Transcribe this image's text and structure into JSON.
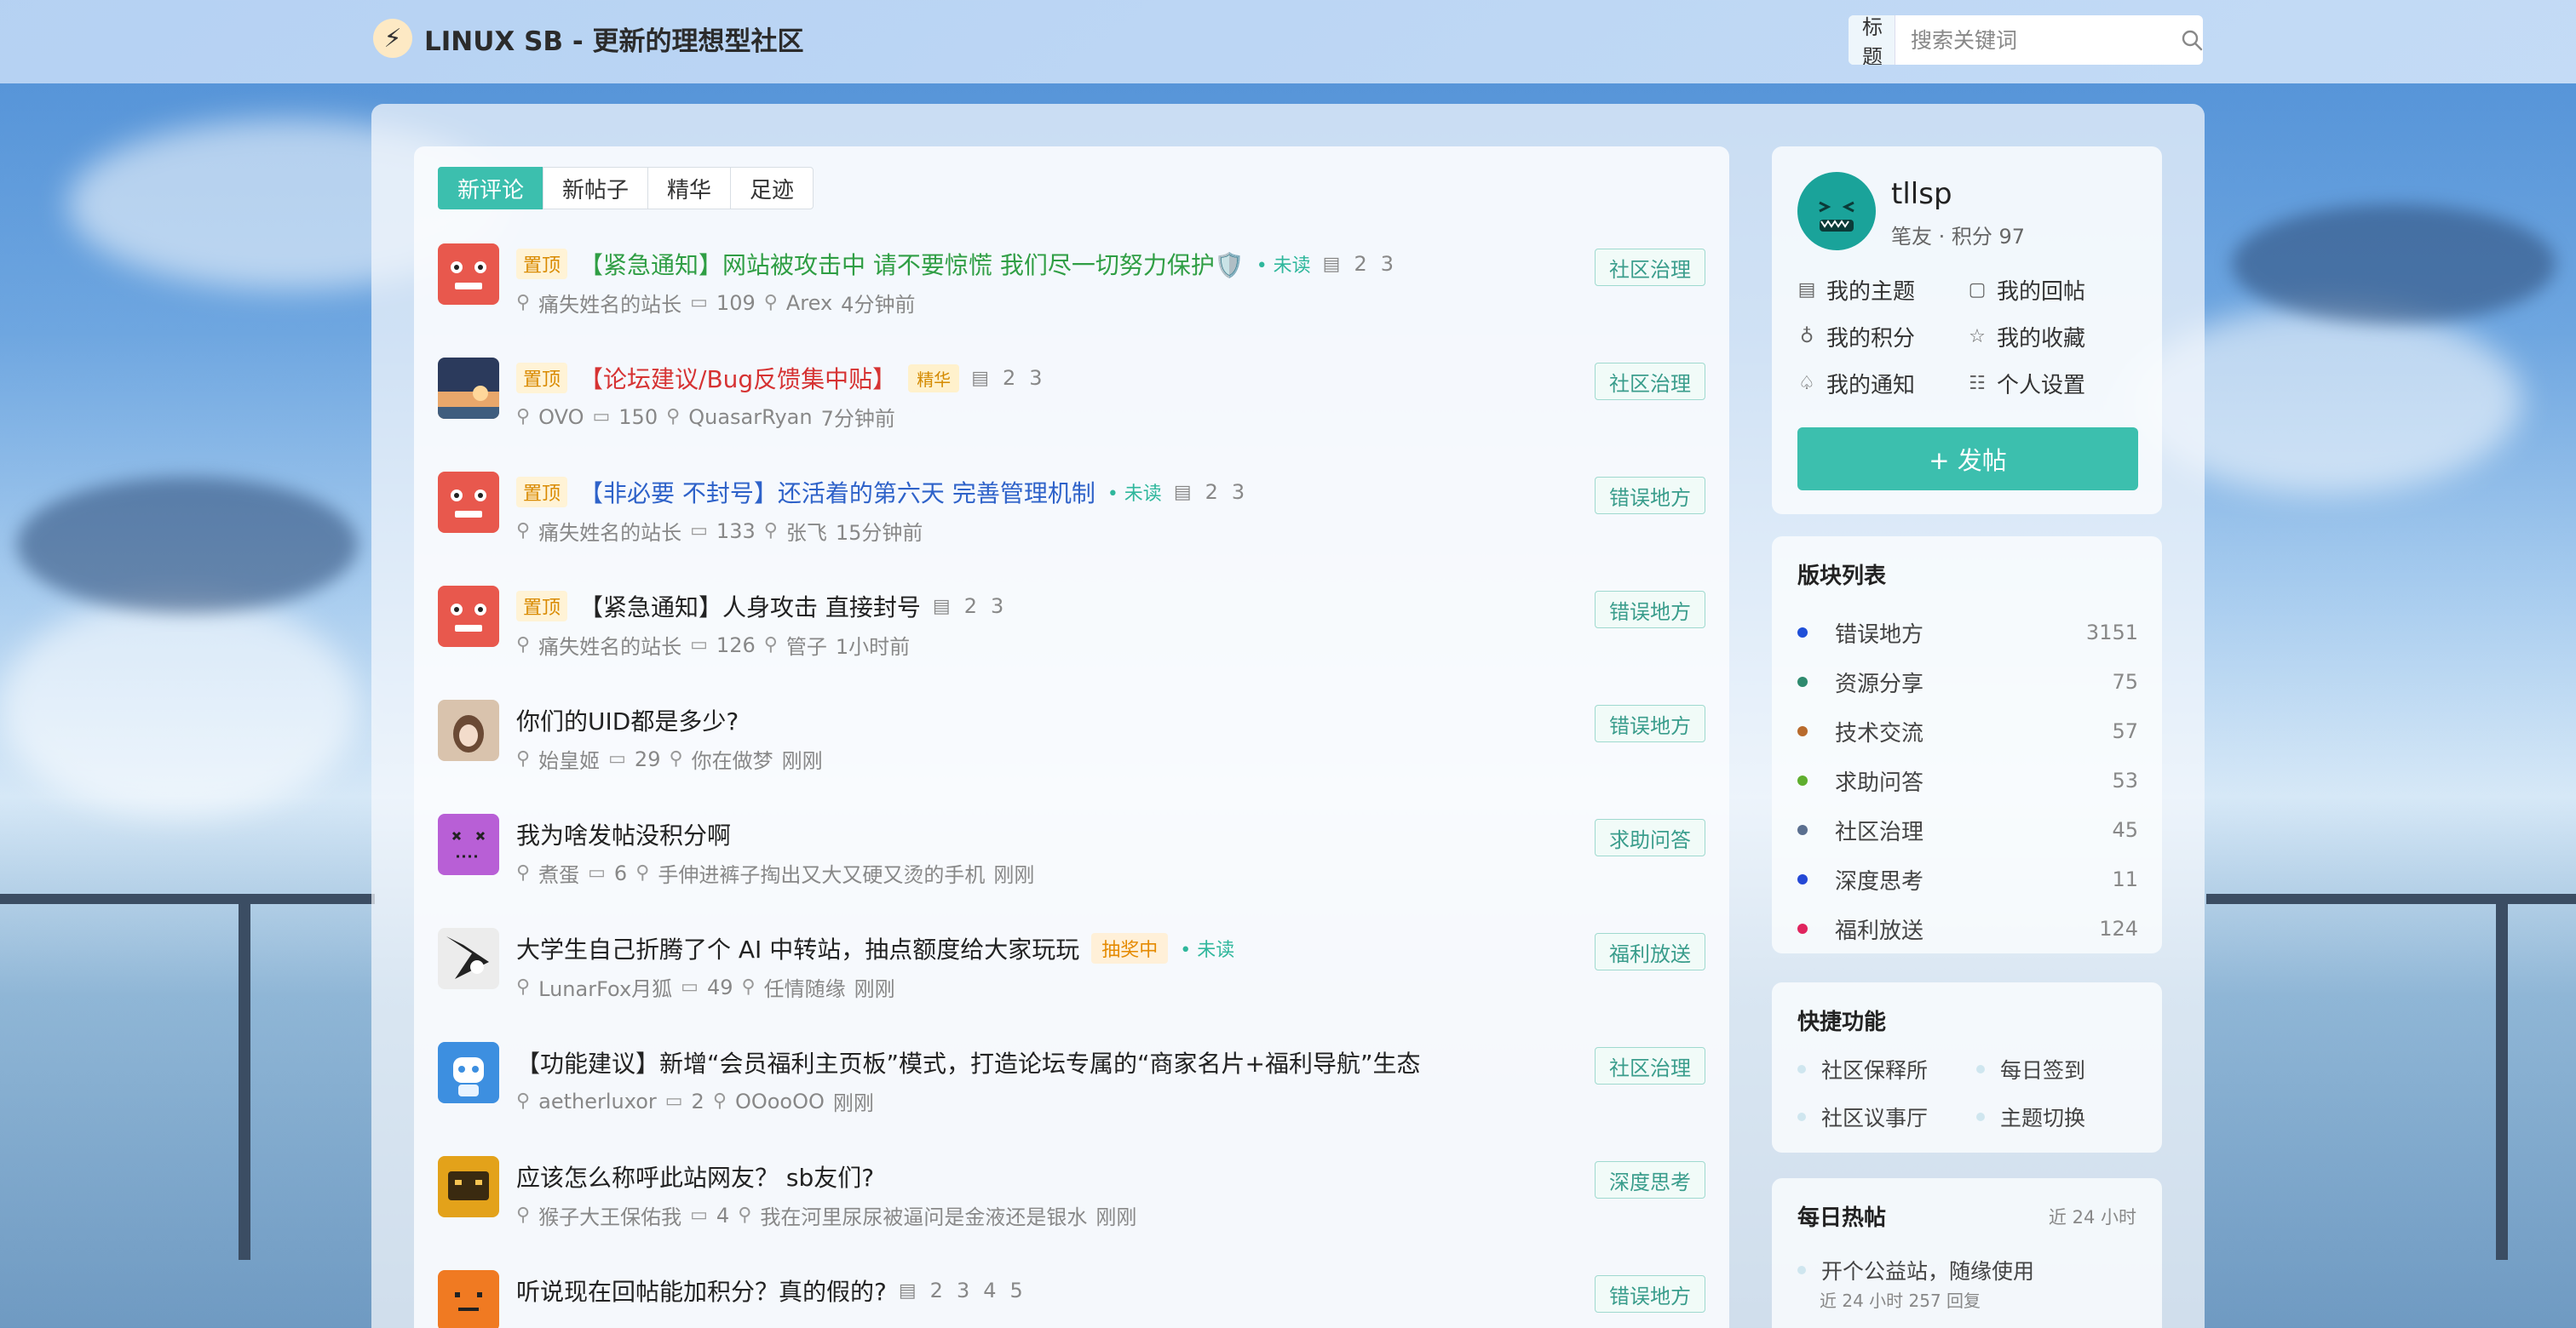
{
  "header": {
    "logo_glyph": "⚡",
    "title": "LINUX SB - 更新的理想型社区",
    "search_type": "标题",
    "search_placeholder": "搜索关键词"
  },
  "tabs": [
    {
      "label": "新评论",
      "active": true
    },
    {
      "label": "新帖子",
      "active": false
    },
    {
      "label": "精华",
      "active": false
    },
    {
      "label": "足迹",
      "active": false
    }
  ],
  "threads": [
    {
      "pin": "置顶",
      "title": "【紧急通知】网站被攻击中 请不要惊慌 我们尽一切努力保护🛡️",
      "title_color": "green",
      "unread": "• 未读",
      "pages": [
        "2",
        "3"
      ],
      "author": "痛失姓名的站长",
      "replies": "109",
      "last_user": "Arex",
      "time": "4分钟前",
      "category": "社区治理",
      "avatar": "red-robot"
    },
    {
      "pin": "置顶",
      "title": "【论坛建议/Bug反馈集中贴】",
      "title_color": "red",
      "essence": "精华",
      "pages": [
        "2",
        "3"
      ],
      "author": "OVO",
      "replies": "150",
      "last_user": "QuasarRyan",
      "time": "7分钟前",
      "category": "社区治理",
      "avatar": "sunset"
    },
    {
      "pin": "置顶",
      "title": "【非必要 不封号】还活着的第六天 完善管理机制",
      "title_color": "blue",
      "unread": "• 未读",
      "pages": [
        "2",
        "3"
      ],
      "author": "痛失姓名的站长",
      "replies": "133",
      "last_user": "张飞",
      "time": "15分钟前",
      "category": "错误地方",
      "avatar": "red-robot"
    },
    {
      "pin": "置顶",
      "title": "【紧急通知】人身攻击 直接封号",
      "title_color": "default",
      "pages": [
        "2",
        "3"
      ],
      "author": "痛失姓名的站长",
      "replies": "126",
      "last_user": "管子",
      "time": "1小时前",
      "category": "错误地方",
      "avatar": "red-robot"
    },
    {
      "title": "你们的UID都是多少?",
      "title_color": "default",
      "pages": [],
      "author": "始皇姬",
      "replies": "29",
      "last_user": "你在做梦",
      "time": "刚刚",
      "category": "错误地方",
      "avatar": "anime"
    },
    {
      "title": "我为啥发帖没积分啊",
      "title_color": "default",
      "pages": [],
      "author": "煮蛋",
      "replies": "6",
      "last_user": "手伸进裤子掏出又大又硬又烫的手机",
      "time": "刚刚",
      "category": "求助问答",
      "avatar": "purple-face"
    },
    {
      "title": "大学生自己折腾了个 AI 中转站，抽点额度给大家玩玩",
      "title_color": "default",
      "lottery": "抽奖中",
      "unread": "• 未读",
      "pages": [],
      "author": "LunarFox月狐",
      "replies": "49",
      "last_user": "任情随缘",
      "time": "刚刚",
      "category": "福利放送",
      "avatar": "manga"
    },
    {
      "title": "【功能建议】新增“会员福利主页板”模式，打造论坛专属的“商家名片+福利导航”生态",
      "title_color": "default",
      "pages": [],
      "author": "aetherluxor",
      "replies": "2",
      "last_user": "OOooOO",
      "time": "刚刚",
      "category": "社区治理",
      "avatar": "blue-robot"
    },
    {
      "title": "应该怎么称呼此站网友？ sb友们?",
      "title_color": "default",
      "pages": [],
      "author": "猴子大王保佑我",
      "replies": "4",
      "last_user": "我在河里尿尿被逼问是金液还是银水",
      "time": "刚刚",
      "category": "深度思考",
      "avatar": "orange-box"
    },
    {
      "title": "听说现在回帖能加积分？真的假的?",
      "title_color": "default",
      "pages": [
        "2",
        "3",
        "4",
        "5"
      ],
      "author": "",
      "replies": "",
      "last_user": "",
      "time": "",
      "category": "错误地方",
      "avatar": "orange-face"
    }
  ],
  "user": {
    "name": "tllsp",
    "sub": "笔友 · 积分 97",
    "links": [
      {
        "label": "我的主题",
        "icon": "document-icon",
        "glyph": "▤"
      },
      {
        "label": "我的回帖",
        "icon": "comment-icon",
        "glyph": "▢"
      },
      {
        "label": "我的积分",
        "icon": "coin-bag-icon",
        "glyph": "♁"
      },
      {
        "label": "我的收藏",
        "icon": "star-icon",
        "glyph": "☆"
      },
      {
        "label": "我的通知",
        "icon": "bell-icon",
        "glyph": "♤"
      },
      {
        "label": "个人设置",
        "icon": "settings-icon",
        "glyph": "☷"
      }
    ],
    "post_button": "+ 发帖"
  },
  "boards": {
    "title": "版块列表",
    "items": [
      {
        "name": "错误地方",
        "count": "3151",
        "color": "#1f4fd8"
      },
      {
        "name": "资源分享",
        "count": "75",
        "color": "#2e8a6e"
      },
      {
        "name": "技术交流",
        "count": "57",
        "color": "#b86a2c"
      },
      {
        "name": "求助问答",
        "count": "53",
        "color": "#5fae2e"
      },
      {
        "name": "社区治理",
        "count": "45",
        "color": "#5a6f8f"
      },
      {
        "name": "深度思考",
        "count": "11",
        "color": "#2448d6"
      },
      {
        "name": "福利放送",
        "count": "124",
        "color": "#e0245e"
      }
    ]
  },
  "quick": {
    "title": "快捷功能",
    "items": [
      "社区保释所",
      "每日签到",
      "社区议事厅",
      "主题切换"
    ]
  },
  "hot": {
    "title": "每日热帖",
    "range": "近 24 小时",
    "item": "开个公益站，随缘使用",
    "item_sub": "近 24 小时 257 回复"
  }
}
